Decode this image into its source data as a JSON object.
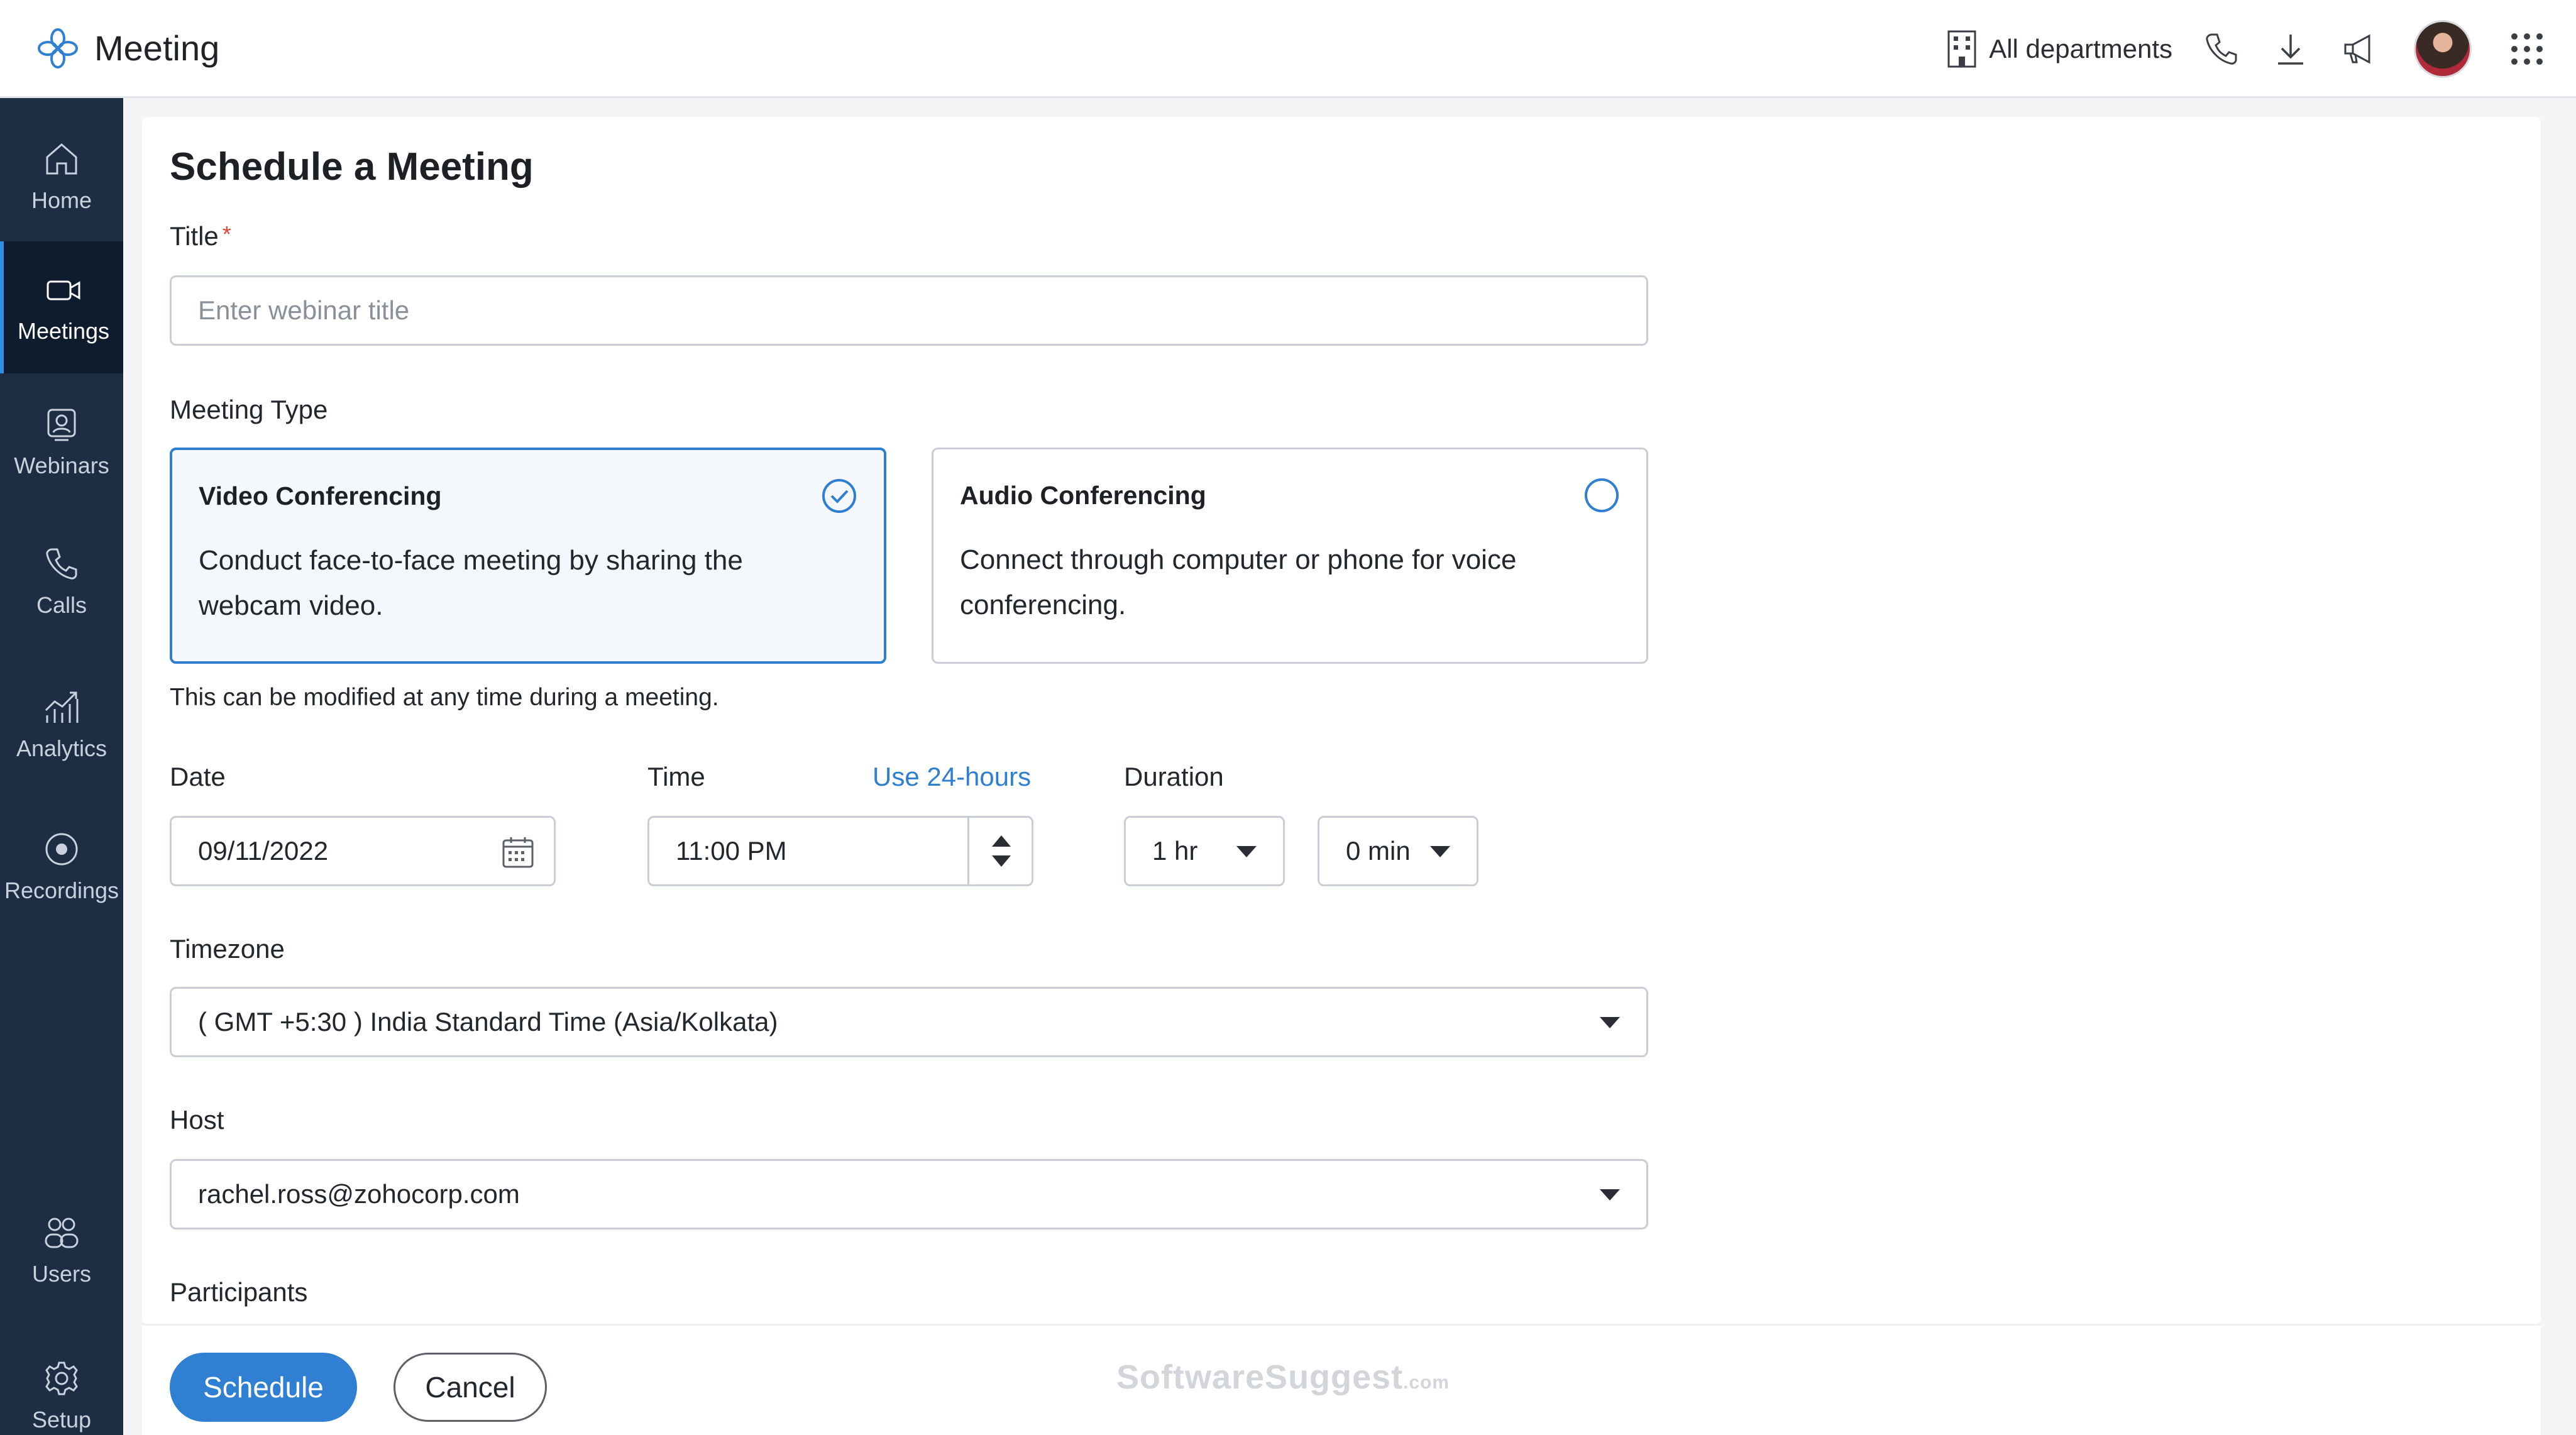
{
  "app": {
    "name": "Meeting"
  },
  "header": {
    "department_label": "All departments",
    "icons": [
      "building-icon",
      "phone-icon",
      "download-icon",
      "megaphone-icon",
      "avatar",
      "apps-grid-icon"
    ]
  },
  "sidebar": {
    "items": [
      {
        "label": "Home",
        "icon": "home-icon",
        "active": false
      },
      {
        "label": "Meetings",
        "icon": "video-camera-icon",
        "active": true
      },
      {
        "label": "Webinars",
        "icon": "webinar-icon",
        "active": false
      },
      {
        "label": "Calls",
        "icon": "phone-icon",
        "active": false
      },
      {
        "label": "Analytics",
        "icon": "analytics-icon",
        "active": false
      },
      {
        "label": "Recordings",
        "icon": "record-icon",
        "active": false
      },
      {
        "label": "Users",
        "icon": "users-icon",
        "active": false
      },
      {
        "label": "Setup",
        "icon": "gear-icon",
        "active": false
      }
    ]
  },
  "form": {
    "page_title": "Schedule a Meeting",
    "title_label": "Title",
    "title_required_mark": "*",
    "title_placeholder": "Enter webinar title",
    "meeting_type_label": "Meeting Type",
    "meeting_types": [
      {
        "title": "Video Conferencing",
        "description": "Conduct face-to-face meeting by sharing the webcam video.",
        "selected": true
      },
      {
        "title": "Audio Conferencing",
        "description": "Connect through computer or phone for voice conferencing.",
        "selected": false
      }
    ],
    "meeting_type_note": "This can be modified at any time during a meeting.",
    "date_label": "Date",
    "date_value": "09/11/2022",
    "time_label": "Time",
    "time_format_link": "Use 24-hours",
    "time_value": "11:00 PM",
    "duration_label": "Duration",
    "duration_hours": "1 hr",
    "duration_minutes": "0 min",
    "timezone_label": "Timezone",
    "timezone_value": "( GMT +5:30 ) India Standard Time (Asia/Kolkata)",
    "host_label": "Host",
    "host_value": "rachel.ross@zohocorp.com",
    "participants_label": "Participants"
  },
  "footer": {
    "schedule_label": "Schedule",
    "cancel_label": "Cancel",
    "watermark": "SoftwareSuggest",
    "watermark_suffix": ".com"
  },
  "colors": {
    "sidebar_bg": "#1c2d44",
    "sidebar_active": "#0f1c2e",
    "accent": "#2f80d3",
    "required": "#e0453a"
  }
}
